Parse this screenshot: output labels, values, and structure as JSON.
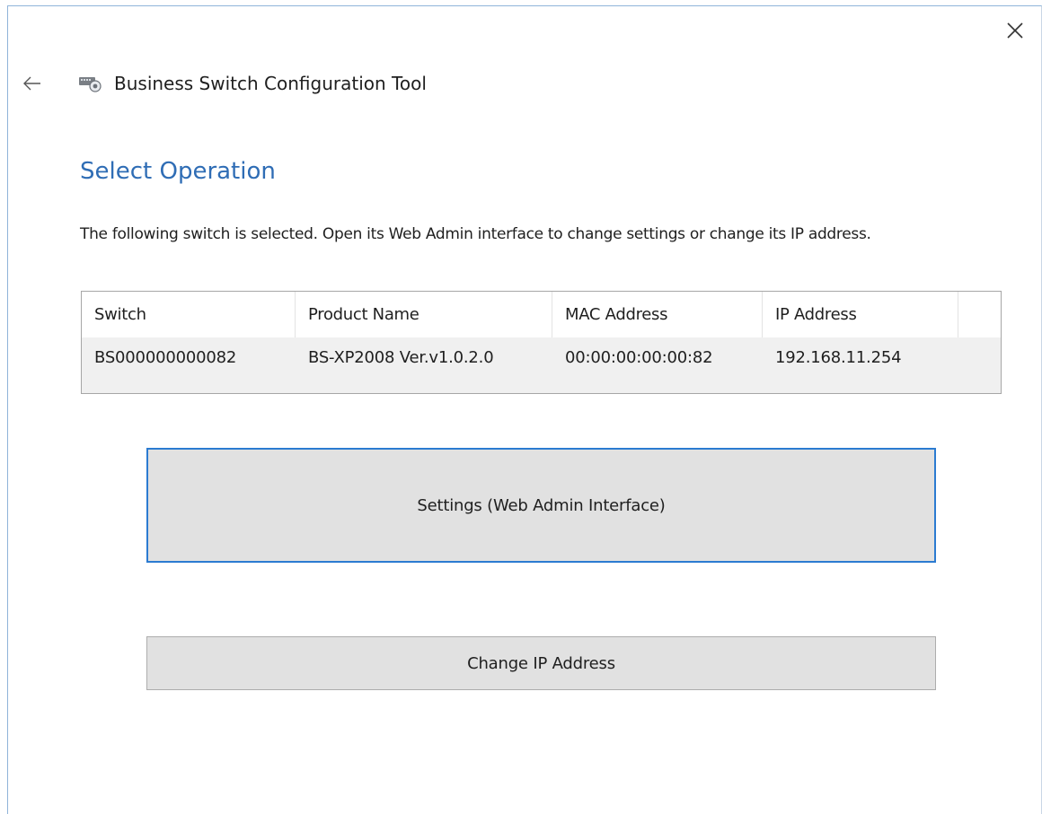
{
  "window": {
    "title": "Business Switch Configuration Tool",
    "accent_color": "#2b7bd1",
    "heading_color": "#2f6db5"
  },
  "icons": {
    "close": "close-icon",
    "back": "back-arrow-icon",
    "app": "network-switch-icon"
  },
  "page": {
    "heading": "Select Operation",
    "description": "The following switch is selected. Open its Web Admin interface to change settings or change its IP address."
  },
  "table": {
    "columns": [
      "Switch",
      "Product Name",
      "MAC Address",
      "IP Address"
    ],
    "rows": [
      {
        "switch": "BS000000000082",
        "product_name": "BS-XP2008 Ver.v1.0.2.0",
        "mac_address": "00:00:00:00:00:82",
        "ip_address": "192.168.11.254"
      }
    ]
  },
  "buttons": {
    "settings_label": "Settings (Web Admin Interface)",
    "change_ip_label": "Change IP Address"
  }
}
